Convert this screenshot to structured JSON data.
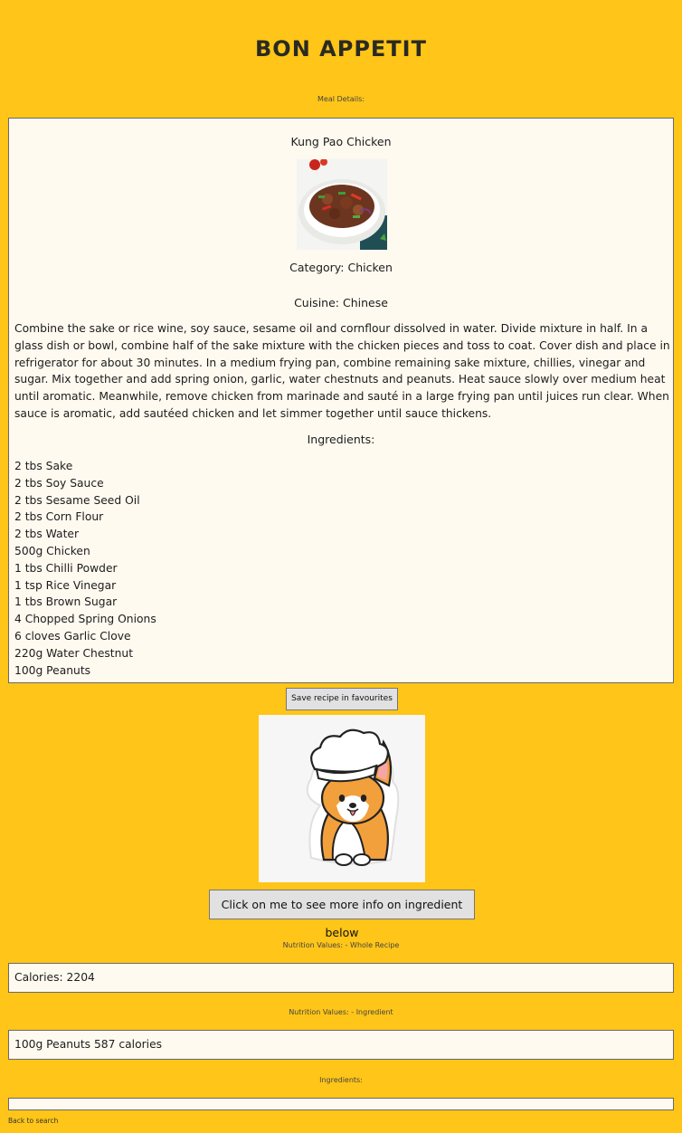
{
  "header": {
    "title": "BON APPETIT"
  },
  "meal": {
    "section_label": "Meal Details:",
    "name": "Kung Pao Chicken",
    "category": "Category: Chicken",
    "cuisine": "Cuisine: Chinese",
    "instructions": "Combine the sake or rice wine, soy sauce, sesame oil and cornflour dissolved in water. Divide mixture in half. In a glass dish or bowl, combine half of the sake mixture with the chicken pieces and toss to coat. Cover dish and place in refrigerator for about 30 minutes. In a medium frying pan, combine remaining sake mixture, chillies, vinegar and sugar. Mix together and add spring onion, garlic, water chestnuts and peanuts. Heat sauce slowly over medium heat until aromatic. Meanwhile, remove chicken from marinade and sauté in a large frying pan until juices run clear. When sauce is aromatic, add sautéed chicken and let simmer together until sauce thickens.",
    "ingredients_heading": "Ingredients:",
    "ingredients": [
      "2 tbs Sake",
      "2 tbs Soy Sauce",
      "2 tbs Sesame Seed Oil",
      "2 tbs Corn Flour",
      "2 tbs Water",
      "500g Chicken",
      "1 tbs Chilli Powder",
      "1 tsp Rice Vinegar",
      "1 tbs Brown Sugar",
      "4 Chopped Spring Onions",
      "6 cloves Garlic Clove",
      "220g Water Chestnut",
      "100g Peanuts"
    ]
  },
  "actions": {
    "save_label": "Save recipe in favourites",
    "info_label": "Click on me to see more info on ingredient below"
  },
  "nutrition": {
    "whole_label": "Nutrition Values: - Whole Recipe",
    "whole_value": "Calories: 2204",
    "ingredient_label": "Nutrition Values: - Ingredient",
    "ingredient_value": "100g Peanuts 587 calories",
    "ingredients_label": "Ingredients:"
  },
  "footer": {
    "back_link": "Back to search"
  },
  "colors": {
    "background": "#ffc518",
    "panel": "#fffaf0",
    "button": "#e1e1e1"
  }
}
